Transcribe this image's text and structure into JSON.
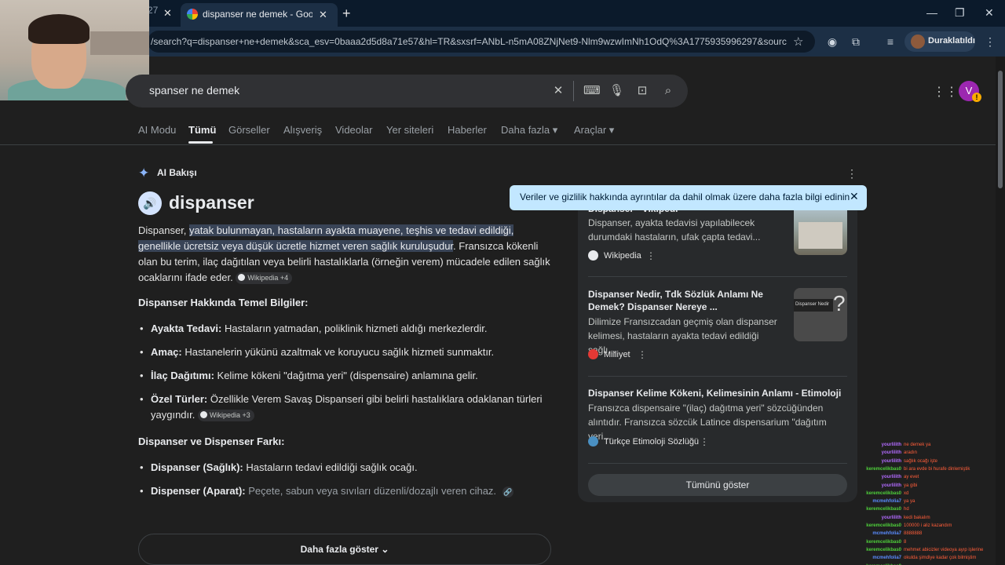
{
  "browser": {
    "inactive_tab_fragment": "27",
    "active_tab_title": "dispanser ne demek - Google'da Ara",
    "url": "/search?q=dispanser+ne+demek&sca_esv=0baaa2d5d8a71e57&hl=TR&sxsrf=ANbL-n5mA08ZNjNet9-Nlm9wzwImNh1OdQ%3A1775935996297&source=...",
    "profile_button": "Duraklatıldı",
    "new_tab": "+",
    "close_glyph": "✕"
  },
  "search": {
    "query": "spanser ne demek",
    "avatar_letter": "V",
    "avatar_badge": "!"
  },
  "nav": {
    "tabs": [
      "AI Modu",
      "Tümü",
      "Görseller",
      "Alışveriş",
      "Videolar",
      "Yer siteleri",
      "Haberler",
      "Daha fazla ▾",
      "Araçlar ▾"
    ],
    "active": "Tümü"
  },
  "ai_overview": {
    "label": "AI Bakışı",
    "word": "dispanser",
    "intro_prefix": "Dispanser, ",
    "intro_highlight": "yatak bulunmayan, hastaların ayakta muayene, teşhis ve tedavi edildiği, genellikle ücretsiz veya düşük ücretle hizmet veren sağlık kuruluşudur",
    "intro_suffix": ". Fransızca kökenli olan bu terim, ilaç dağıtılan veya belirli hastalıklarla (örneğin verem) mücadele edilen sağlık ocaklarını ifade eder.",
    "chip1": "Wikipedia +4",
    "section1_title": "Dispanser Hakkında Temel Bilgiler:",
    "items1": [
      {
        "term": "Ayakta Tedavi:",
        "text": " Hastaların yatmadan, poliklinik hizmeti aldığı merkezlerdir."
      },
      {
        "term": "Amaç:",
        "text": " Hastanelerin yükünü azaltmak ve koruyucu sağlık hizmeti sunmaktır."
      },
      {
        "term": "İlaç Dağıtımı:",
        "text": " Kelime kökeni \"dağıtma yeri\" (dispensaire) anlamına gelir."
      },
      {
        "term": "Özel Türler:",
        "text": " Özellikle Verem Savaş Dispanseri gibi belirli hastalıklara odaklanan türleri yaygındır."
      }
    ],
    "chip2": "Wikipedia +3",
    "section2_title": "Dispanser ve Dispenser Farkı:",
    "items2": [
      {
        "term": "Dispanser (Sağlık):",
        "text": " Hastaların tedavi edildiği sağlık ocağı."
      },
      {
        "term": "Dispenser (Aparat):",
        "text": " Peçete, sabun veya sıvıları düzenli/dozajlı veren cihaz."
      }
    ],
    "more_button": "Daha fazla göster"
  },
  "tooltip": "Veriler ve gizlilik hakkında ayrıntılar da dahil olmak üzere daha fazla bilgi edinin",
  "sources": [
    {
      "title": "Dispanser - Vikipedi",
      "snippet": "Dispanser, ayakta tedavisi yapılabilecek durumdaki hastaların, ufak çapta tedavi...",
      "site": "Wikipedia"
    },
    {
      "title": "Dispanser Nedir, Tdk Sözlük Anlamı Ne Demek? Dispanser Nereye ...",
      "snippet": "Dilimize Fransızcadan geçmiş olan dispanser kelimesi, hastaların ayakta tedavi edildiği sağlı...",
      "site": "Milliyet",
      "thumb_text": "Dispanser Nedir"
    },
    {
      "title": "Dispanser Kelime Kökeni, Kelimesinin Anlamı - Etimoloji",
      "snippet": "Fransızca dispensaire \"(ilaç) dağıtma yeri\" sözcüğünden alıntıdır. Fransızca sözcük Latince dispensarium \"dağıtım yeri...",
      "site": "Türkçe Etimoloji Sözlüğü"
    }
  ],
  "show_all": "Tümünü göster",
  "chat": [
    {
      "user": "yourlilith",
      "msg": "ne demek ya",
      "color": "#b36bff"
    },
    {
      "user": "yourlilith",
      "msg": "aradın",
      "color": "#b36bff"
    },
    {
      "user": "yourlilith",
      "msg": "sağlık ocağı işte",
      "color": "#b36bff"
    },
    {
      "user": "keremcelikbas0",
      "msg": "bi ara evde bi hurafe dinlemiştik",
      "color": "#4fd13b"
    },
    {
      "user": "yourlilith",
      "msg": "ay evet",
      "color": "#b36bff"
    },
    {
      "user": "yourlilith",
      "msg": "ya gibi",
      "color": "#b36bff"
    },
    {
      "user": "keremcelikbas0",
      "msg": "xd",
      "color": "#4fd13b"
    },
    {
      "user": "mcmehfolia7",
      "msg": "ya ya",
      "color": "#5a8cff"
    },
    {
      "user": "keremcelikbas0",
      "msg": "hd",
      "color": "#4fd13b"
    },
    {
      "user": "yourlilith",
      "msg": "kedi bakalım",
      "color": "#b36bff"
    },
    {
      "user": "keremcelikbas0",
      "msg": "100000 i aliz kazandım",
      "color": "#4fd13b"
    },
    {
      "user": "mcmehfolia7",
      "msg": "8888888",
      "color": "#5a8cff"
    },
    {
      "user": "keremcelikbas0",
      "msg": "8",
      "color": "#4fd13b"
    },
    {
      "user": "keremcelikbas0",
      "msg": "mehmet abicizler videoya ayıp işlerine",
      "color": "#4fd13b"
    },
    {
      "user": "mcmehfolia7",
      "msg": "okulda şimdiye kadar çok bilmiştim",
      "color": "#5a8cff"
    },
    {
      "user": "keremcelikbas0",
      "msg": "...",
      "color": "#4fd13b"
    }
  ]
}
